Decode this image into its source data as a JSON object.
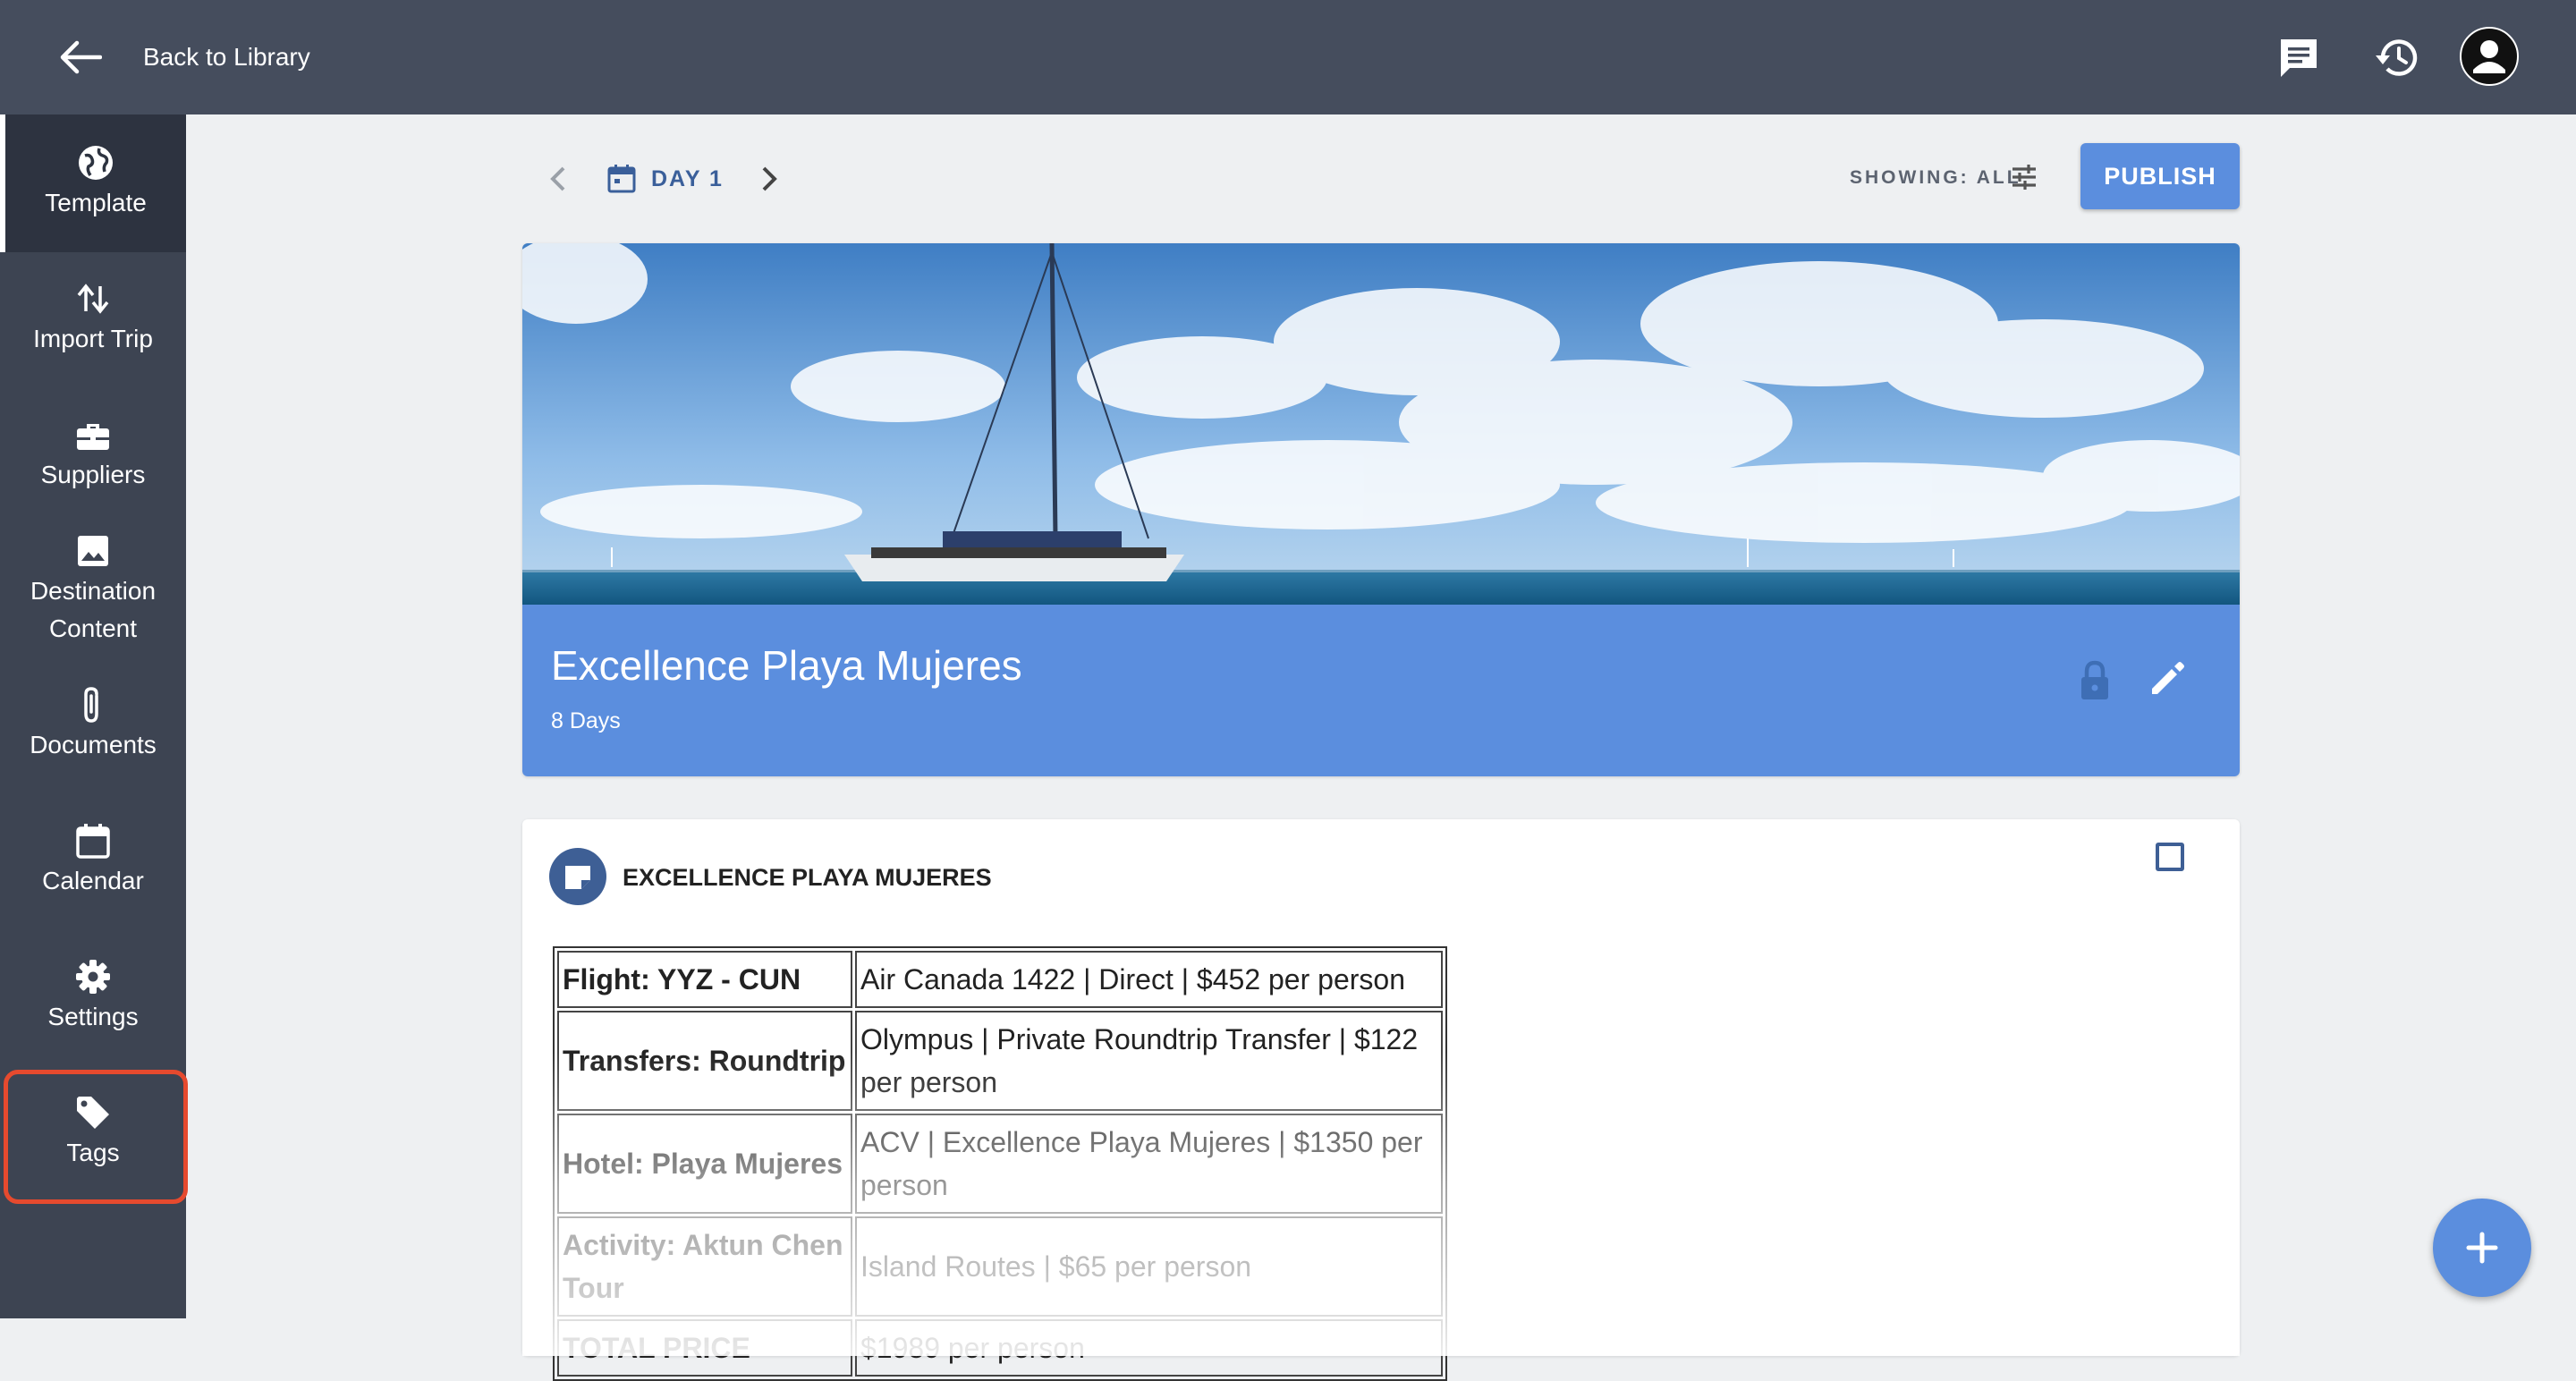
{
  "header": {
    "back_label": "Back to Library",
    "icons": [
      "chat-icon",
      "history-icon",
      "account-avatar"
    ]
  },
  "sidebar": {
    "items": [
      {
        "label": "Template",
        "icon": "globe-icon",
        "active": true
      },
      {
        "label": "Import Trip",
        "icon": "import-arrows-icon"
      },
      {
        "label": "Suppliers",
        "icon": "briefcase-icon"
      },
      {
        "label": "Destination Content",
        "icon": "image-icon"
      },
      {
        "label": "Documents",
        "icon": "paperclip-icon"
      },
      {
        "label": "Calendar",
        "icon": "calendar-icon"
      },
      {
        "label": "Settings",
        "icon": "gear-icon"
      },
      {
        "label": "Tags",
        "icon": "tag-icon",
        "highlighted": true
      }
    ]
  },
  "toolbar": {
    "day_label": "DAY 1",
    "showing_label": "SHOWING: ALL",
    "publish_label": "PUBLISH"
  },
  "hero": {
    "title": "Excellence Playa Mujeres",
    "subtitle": "8 Days"
  },
  "card": {
    "title": "EXCELLENCE PLAYA MUJERES",
    "rows": [
      {
        "key": "Flight: YYZ - CUN",
        "value": "Air Canada 1422 | Direct | $452 per person"
      },
      {
        "key": "Transfers: Roundtrip",
        "value": "Olympus | Private Roundtrip Transfer | $122 per person"
      },
      {
        "key": "Hotel: Playa Mujeres",
        "value": "ACV | Excellence Playa Mujeres | $1350 per person"
      },
      {
        "key": "Activity: Aktun Chen Tour",
        "value": "Island Routes | $65 per person"
      },
      {
        "key": "TOTAL PRICE",
        "value": "$1989 per person"
      }
    ]
  },
  "colors": {
    "topbar": "#454d5d",
    "sidebar": "#3d4452",
    "accent": "#5b8ede",
    "highlight": "#e64a2e"
  }
}
